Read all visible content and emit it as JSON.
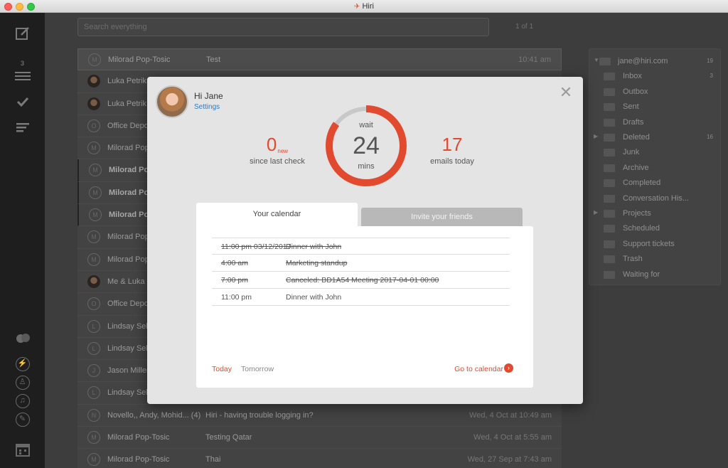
{
  "window": {
    "title": "Hiri"
  },
  "rail": {
    "badge": "3"
  },
  "search": {
    "placeholder": "Search everything"
  },
  "pager": {
    "label": "1 of 1"
  },
  "mail": [
    {
      "initial": "M",
      "from": "Milorad Pop-Tosic",
      "subject": "Test",
      "date": "10:41 am",
      "selected": true,
      "bold": false,
      "photo": false
    },
    {
      "initial": "",
      "from": "Luka Petrik",
      "subject": "",
      "date": "",
      "bold": false,
      "photo": true
    },
    {
      "initial": "",
      "from": "Luka Petrik",
      "subject": "",
      "date": "",
      "bold": false,
      "photo": true
    },
    {
      "initial": "O",
      "from": "Office Depo",
      "subject": "",
      "date": "",
      "bold": false,
      "photo": false
    },
    {
      "initial": "M",
      "from": "Milorad Pop",
      "subject": "",
      "date": "",
      "bold": false,
      "photo": false
    },
    {
      "initial": "M",
      "from": "Milorad Pop",
      "subject": "",
      "date": "",
      "bold": true,
      "photo": false
    },
    {
      "initial": "M",
      "from": "Milorad Pop",
      "subject": "",
      "date": "",
      "bold": true,
      "photo": false
    },
    {
      "initial": "M",
      "from": "Milorad Pop",
      "subject": "",
      "date": "",
      "bold": true,
      "photo": false
    },
    {
      "initial": "M",
      "from": "Milorad Pop",
      "subject": "",
      "date": "",
      "bold": false,
      "photo": false
    },
    {
      "initial": "M",
      "from": "Milorad Pop",
      "subject": "",
      "date": "",
      "bold": false,
      "photo": false
    },
    {
      "initial": "",
      "from": "Me & Luka",
      "subject": "",
      "date": "",
      "bold": false,
      "photo": true
    },
    {
      "initial": "O",
      "from": "Office Depo",
      "subject": "",
      "date": "",
      "bold": false,
      "photo": false
    },
    {
      "initial": "L",
      "from": "Lindsay Selv",
      "subject": "",
      "date": "",
      "bold": false,
      "photo": false
    },
    {
      "initial": "L",
      "from": "Lindsay Selv",
      "subject": "",
      "date": "",
      "bold": false,
      "photo": false
    },
    {
      "initial": "J",
      "from": "Jason Miller",
      "subject": "",
      "date": "",
      "bold": false,
      "photo": false
    },
    {
      "initial": "L",
      "from": "Lindsay Selv",
      "subject": "",
      "date": "",
      "bold": false,
      "photo": false
    },
    {
      "initial": "N",
      "from": "Novello,, Andy, Mohid...  (4)",
      "subject": "Hiri - having trouble logging in?",
      "date": "Wed, 4 Oct at 10:49 am",
      "bold": false,
      "photo": false
    },
    {
      "initial": "M",
      "from": "Milorad Pop-Tosic",
      "subject": "Testing Qatar",
      "date": "Wed, 4 Oct at 5:55 am",
      "bold": false,
      "photo": false
    },
    {
      "initial": "M",
      "from": "Milorad Pop-Tosic",
      "subject": "Thai",
      "date": "Wed, 27 Sep at 7:43 am",
      "bold": false,
      "photo": false
    }
  ],
  "folders": [
    {
      "name": "jane@hiri.com",
      "count": "19",
      "arrow": "▼",
      "indent": false
    },
    {
      "name": "Inbox",
      "count": "3",
      "arrow": "",
      "indent": true
    },
    {
      "name": "Outbox",
      "count": "",
      "arrow": "",
      "indent": true
    },
    {
      "name": "Sent",
      "count": "",
      "arrow": "",
      "indent": true
    },
    {
      "name": "Drafts",
      "count": "",
      "arrow": "",
      "indent": true
    },
    {
      "name": "Deleted",
      "count": "16",
      "arrow": "▶",
      "indent": true
    },
    {
      "name": "Junk",
      "count": "",
      "arrow": "",
      "indent": true
    },
    {
      "name": "Archive",
      "count": "",
      "arrow": "",
      "indent": true
    },
    {
      "name": "Completed",
      "count": "",
      "arrow": "",
      "indent": true
    },
    {
      "name": "Conversation His...",
      "count": "",
      "arrow": "",
      "indent": true
    },
    {
      "name": "Projects",
      "count": "",
      "arrow": "▶",
      "indent": true
    },
    {
      "name": "Scheduled",
      "count": "",
      "arrow": "",
      "indent": true
    },
    {
      "name": "Support tickets",
      "count": "",
      "arrow": "",
      "indent": true
    },
    {
      "name": "Trash",
      "count": "",
      "arrow": "",
      "indent": true
    },
    {
      "name": "Waiting for",
      "count": "",
      "arrow": "",
      "indent": true
    }
  ],
  "modal": {
    "close": "✕",
    "greeting": "Hi Jane",
    "settings": "Settings",
    "new_count": "0",
    "new_suffix": "new",
    "new_label": "since last check",
    "wait_label": "wait",
    "wait_value": "24",
    "wait_unit": "mins",
    "wait_progress": 0.85,
    "emails_today": "17",
    "emails_label": "emails today",
    "tab_calendar": "Your calendar",
    "tab_invite": "Invite your friends",
    "events": [
      {
        "time": "11:00 pm 03/12/2017",
        "event": "Dinner with John",
        "struck": true
      },
      {
        "time": "4:00 am",
        "event": "Marketing standup ",
        "struck": true
      },
      {
        "time": "7:00 pm",
        "event": "Canceled: BD1A54 Meeting 2017-04-01 00:00",
        "struck": true
      },
      {
        "time": "11:00 pm",
        "event": "Dinner with John",
        "struck": false
      }
    ],
    "today": "Today",
    "tomorrow": "Tomorrow",
    "goto": "Go to calendar",
    "goto_icon": "›"
  },
  "colors": {
    "accent": "#e24a2f",
    "link": "#2f7bbf"
  }
}
